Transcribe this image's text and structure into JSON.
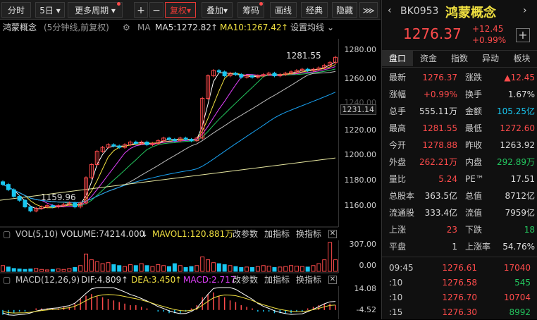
{
  "toolbar": {
    "fenshi": "分时",
    "five_day": "5日",
    "more_period": "更多周期",
    "plus": "+",
    "minus": "−",
    "fuquan": "复权",
    "diejia": "叠加",
    "chouma": "筹码",
    "huaxian": "画线",
    "jingdian": "经典",
    "yincang": "隐藏"
  },
  "chart_header": {
    "name": "鸿蒙概念",
    "desc": "(5分钟线,前复权)",
    "ma_label": "MA",
    "ma5": "MA5:1272.82",
    "ma10": "MA10:1267.42",
    "set_ma": "设置均线"
  },
  "price_axis": {
    "ticks": [
      "1280.00",
      "1260.00",
      "1240.00",
      "1231.14",
      "1220.00",
      "1200.00",
      "1180.00",
      "1160.00"
    ]
  },
  "annotations": {
    "high_label": "1281.55",
    "low_label": "1159.96"
  },
  "vol_header": {
    "name": "VOL(5,10)",
    "volume": "VOLUME:74214.000",
    "mavol1": "MAVOL1:120.881万",
    "change_params": "改参数",
    "add_indicator": "加指标",
    "switch_indicator": "换指标"
  },
  "vol_axis": {
    "top": "307.00",
    "bottom": "0.00"
  },
  "macd_header": {
    "name": "MACD(12,26,9)",
    "dif": "DIF:4.809",
    "dea": "DEA:3.450",
    "macd": "MACD:2.717",
    "change_params": "改参数",
    "add_indicator": "加指标",
    "switch_indicator": "换指标"
  },
  "macd_axis": {
    "top": "14.08",
    "bottom": "-4.52"
  },
  "quote": {
    "code": "BK0953",
    "name": "鸿蒙概念",
    "price": "1276.37",
    "change": "+12.45",
    "change_pct": "+0.99%"
  },
  "tabs": [
    "盘口",
    "资金",
    "指数",
    "异动",
    "板块"
  ],
  "stats": [
    {
      "l1": "最新",
      "v1": "1276.37",
      "c1": "r",
      "l2": "涨跌",
      "v2": "▲12.45",
      "c2": "r"
    },
    {
      "l1": "涨幅",
      "v1": "+0.99%",
      "c1": "r",
      "l2": "换手",
      "v2": "1.67%",
      "c2": "w"
    },
    {
      "l1": "总手",
      "v1": "555.11万",
      "c1": "w",
      "l2": "金额",
      "v2": "105.25亿",
      "c2": "c"
    },
    {
      "l1": "最高",
      "v1": "1281.55",
      "c1": "r",
      "l2": "最低",
      "v2": "1272.60",
      "c2": "r"
    },
    {
      "l1": "今开",
      "v1": "1278.88",
      "c1": "r",
      "l2": "昨收",
      "v2": "1263.92",
      "c2": "w"
    },
    {
      "l1": "外盘",
      "v1": "262.21万",
      "c1": "r",
      "l2": "内盘",
      "v2": "292.89万",
      "c2": "g"
    },
    {
      "l1": "量比",
      "v1": "5.24",
      "c1": "r",
      "l2": "PE™",
      "v2": "17.51",
      "c2": "w"
    },
    {
      "l1": "总股本",
      "v1": "363.5亿",
      "c1": "w",
      "l2": "总值",
      "v2": "8712亿",
      "c2": "w"
    },
    {
      "l1": "流通股",
      "v1": "333.4亿",
      "c1": "w",
      "l2": "流值",
      "v2": "7959亿",
      "c2": "w"
    },
    {
      "l1": "上涨",
      "v1": "23",
      "c1": "r",
      "l2": "下跌",
      "v2": "18",
      "c2": "g"
    },
    {
      "l1": "平盘",
      "v1": "1",
      "c1": "w",
      "l2": "上涨率",
      "v2": "54.76%",
      "c2": "w"
    }
  ],
  "ticks_list": [
    {
      "time": "09:45",
      "price": "1276.61",
      "vol": "17040",
      "vc": "r"
    },
    {
      "time": ":10",
      "price": "1276.58",
      "vol": "545",
      "vc": "g"
    },
    {
      "time": ":10",
      "price": "1276.70",
      "vol": "10704",
      "vc": "r"
    },
    {
      "time": ":15",
      "price": "1276.30",
      "vol": "8992",
      "vc": "g"
    }
  ],
  "chart_data": {
    "type": "line",
    "price": {
      "ylim": [
        1150,
        1290
      ],
      "close": [
        1180,
        1176,
        1171,
        1168,
        1163,
        1160,
        1162,
        1163,
        1164,
        1163,
        1164,
        1165,
        1166,
        1163,
        1166,
        1185,
        1195,
        1205,
        1208,
        1210,
        1209,
        1208,
        1210,
        1212,
        1211,
        1212,
        1210,
        1211,
        1213,
        1215,
        1214,
        1213,
        1215,
        1214,
        1213,
        1215,
        1245,
        1262,
        1266,
        1265,
        1262,
        1264,
        1263,
        1261,
        1262,
        1261,
        1262,
        1263,
        1264,
        1262,
        1263,
        1264,
        1265,
        1266,
        1267,
        1266,
        1267,
        1268,
        1270,
        1272,
        1276
      ]
    },
    "volume": {
      "ylim": [
        0,
        307
      ],
      "values": [
        60,
        45,
        30,
        25,
        20,
        25,
        30,
        20,
        15,
        20,
        25,
        20,
        30,
        40,
        60,
        180,
        120,
        100,
        80,
        90,
        70,
        60,
        50,
        70,
        60,
        80,
        60,
        50,
        70,
        60,
        50,
        80,
        60,
        40,
        50,
        60,
        150,
        120,
        90,
        80,
        70,
        60,
        50,
        40,
        45,
        40,
        50,
        60,
        55,
        40,
        45,
        50,
        60,
        55,
        50,
        45,
        60,
        80,
        120,
        300,
        120
      ]
    },
    "macd": {
      "ylim": [
        -4.52,
        14.08
      ],
      "bars": [
        -3,
        -3,
        -2,
        -1,
        -1,
        0,
        1,
        1,
        1,
        1,
        1,
        2,
        2,
        4,
        7,
        9,
        10,
        9,
        8,
        7,
        6,
        5,
        4,
        3,
        3,
        2,
        1,
        0,
        -1,
        -1,
        -2,
        -2,
        -2,
        -1,
        1,
        3,
        8,
        10,
        11,
        9,
        8,
        6,
        5,
        3,
        2,
        1,
        -1,
        -1,
        -1,
        -2,
        -2,
        -2,
        -2,
        -1,
        -1,
        1,
        2,
        3,
        4,
        4,
        3
      ]
    }
  }
}
